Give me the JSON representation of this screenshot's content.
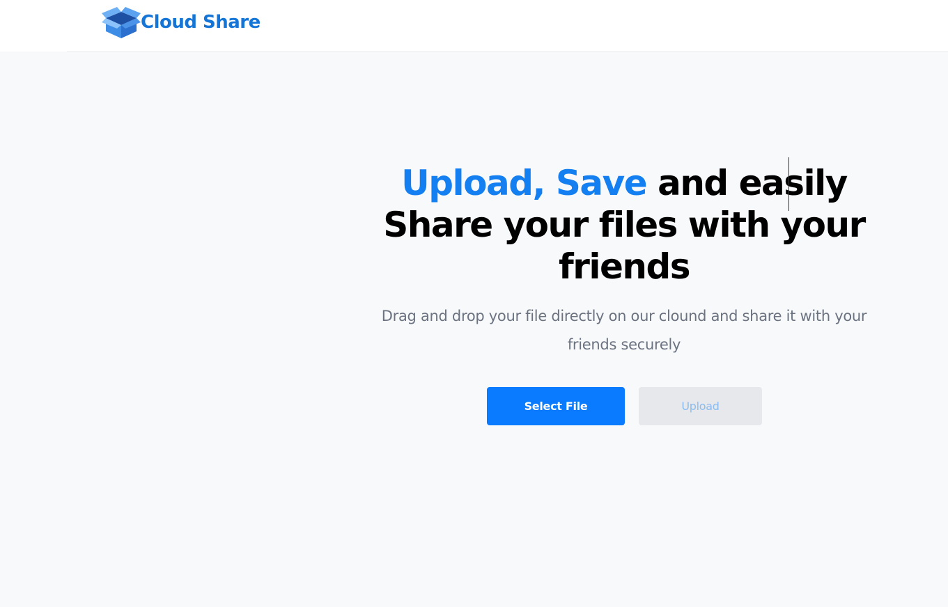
{
  "brand": {
    "name": "Cloud Share",
    "icon": "box-icon",
    "color": "#1575d6"
  },
  "hero": {
    "headline_accent": "Upload, Save",
    "headline_rest_line1": " and easily",
    "headline_line2": "Share your files with your",
    "headline_line3": "friends",
    "subtitle": "Drag and drop your file directly on our clound and share it with your friends securely",
    "accent_color": "#137ff0"
  },
  "actions": {
    "select_label": "Select File",
    "upload_label": "Upload",
    "upload_disabled": true,
    "primary_color": "#0a7bff"
  }
}
